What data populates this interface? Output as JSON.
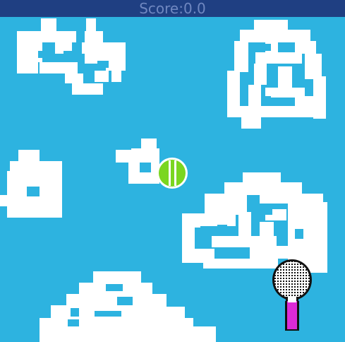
{
  "hud": {
    "score_label": "Score:",
    "score_value": "0.0"
  },
  "colors": {
    "sky": "#2db3e0",
    "hud_bar": "#1f3f82",
    "hud_text": "#6f87c0",
    "cloud": "#ffffff",
    "ball": "#7ad61f",
    "racket_handle": "#dd2ad6"
  },
  "sprites": {
    "clouds": [
      "cloud",
      "cloud",
      "cloud",
      "cloud",
      "cloud",
      "cloud"
    ],
    "ball": "tennis-ball",
    "racket": "tennis-racket"
  }
}
